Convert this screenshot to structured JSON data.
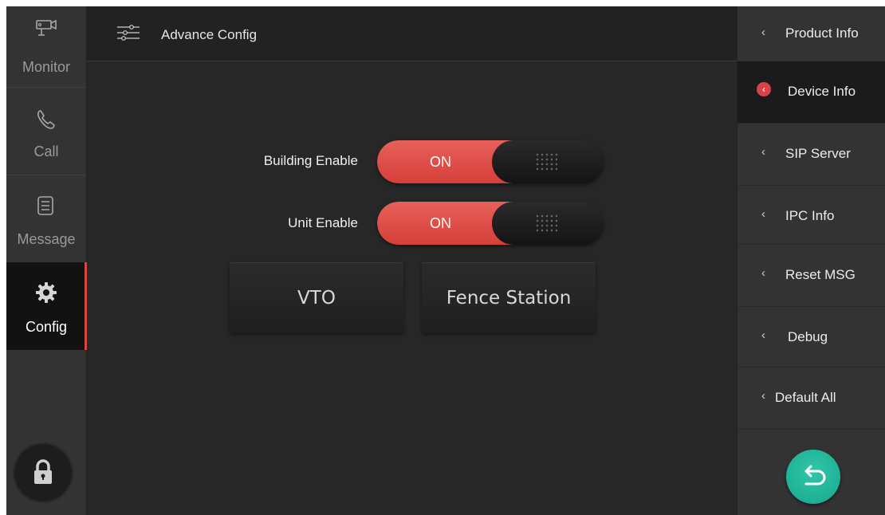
{
  "sidebar": {
    "items": [
      {
        "label": "Monitor",
        "icon": "camera-icon"
      },
      {
        "label": "Call",
        "icon": "phone-icon"
      },
      {
        "label": "Message",
        "icon": "message-icon"
      },
      {
        "label": "Config",
        "icon": "gear-icon",
        "active": true
      }
    ],
    "lock_icon": "lock-icon"
  },
  "header": {
    "title": "Advance Config",
    "icon": "sliders-icon"
  },
  "main": {
    "toggles": [
      {
        "label": "Building Enable",
        "state": "ON"
      },
      {
        "label": "Unit Enable",
        "state": "ON"
      }
    ],
    "buttons": [
      {
        "label": "VTO"
      },
      {
        "label": "Fence Station"
      }
    ]
  },
  "right_menu": {
    "items": [
      {
        "label": "Product Info"
      },
      {
        "label": "Device Info",
        "active": true
      },
      {
        "label": "SIP Server"
      },
      {
        "label": "IPC Info"
      },
      {
        "label": "Reset MSG"
      },
      {
        "label": "Debug"
      },
      {
        "label": "Default All"
      }
    ],
    "chevron": "‹",
    "back_icon": "back-arrow-icon"
  },
  "colors": {
    "accent_red": "#d6473f",
    "back_green": "#1fb79a",
    "background": "#272727"
  }
}
